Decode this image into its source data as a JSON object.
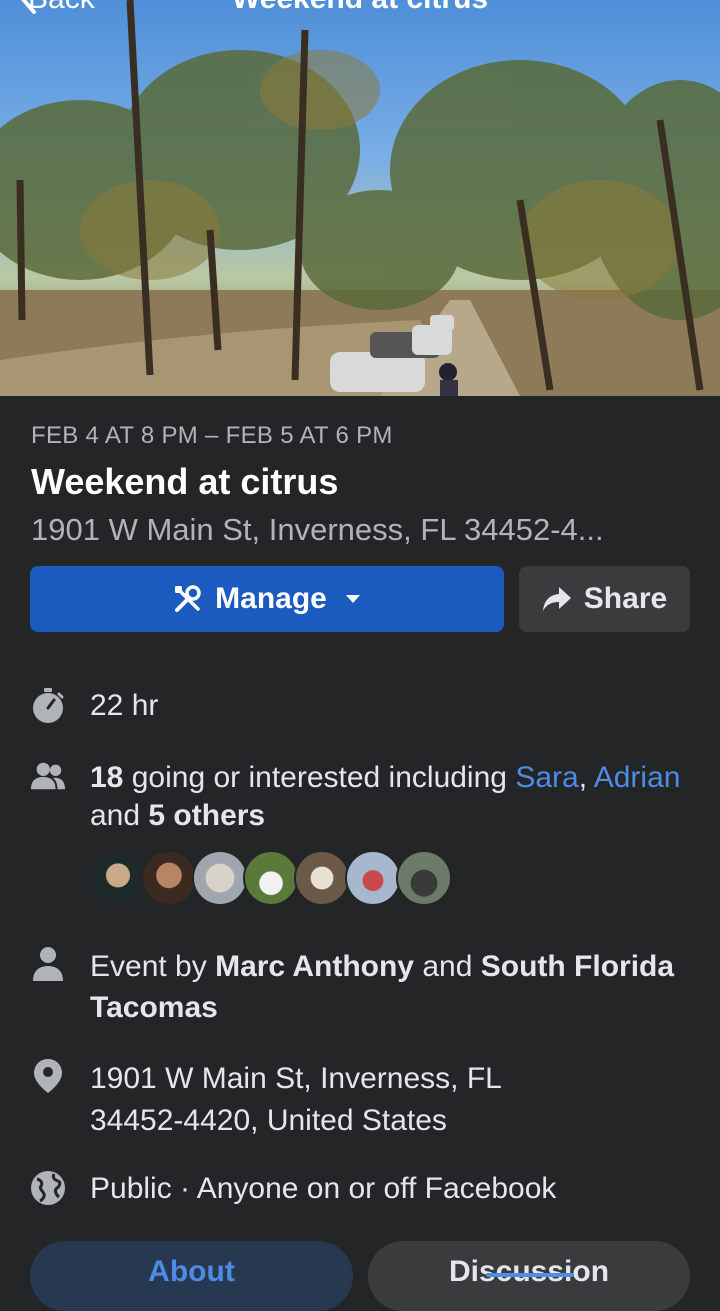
{
  "nav": {
    "back_label": "Back",
    "title": "Weekend at citrus"
  },
  "cover": {
    "image": "forest-trail-trucks-photo"
  },
  "event": {
    "date": "FEB 4 AT 8 PM – FEB 5 AT 6 PM",
    "title": "Weekend at citrus",
    "address_short": "1901 W Main St, Inverness, FL 34452-4..."
  },
  "actions": {
    "manage_label": "Manage",
    "share_label": "Share"
  },
  "details": {
    "duration": "22 hr",
    "going": {
      "count": "18",
      "text": "going or interested including",
      "name1": "Sara",
      "comma": ",",
      "name2": "Adrian",
      "and": "and",
      "others": "5 others"
    },
    "host": {
      "prefix": "Event by",
      "host1": "Marc Anthony",
      "and": "and",
      "host2": "South Florida Tacomas"
    },
    "location": {
      "line1": "1901 W Main St, Inverness, FL",
      "line2": "34452-4420, United States"
    },
    "privacy": "Public · Anyone on or off Facebook"
  },
  "tabs": {
    "about": "About",
    "discussion": "Discussion"
  },
  "colors": {
    "background": "#242526",
    "accent": "#1b5bbf",
    "link": "#4c8ce4",
    "secondary_text": "#b0b3b8"
  }
}
